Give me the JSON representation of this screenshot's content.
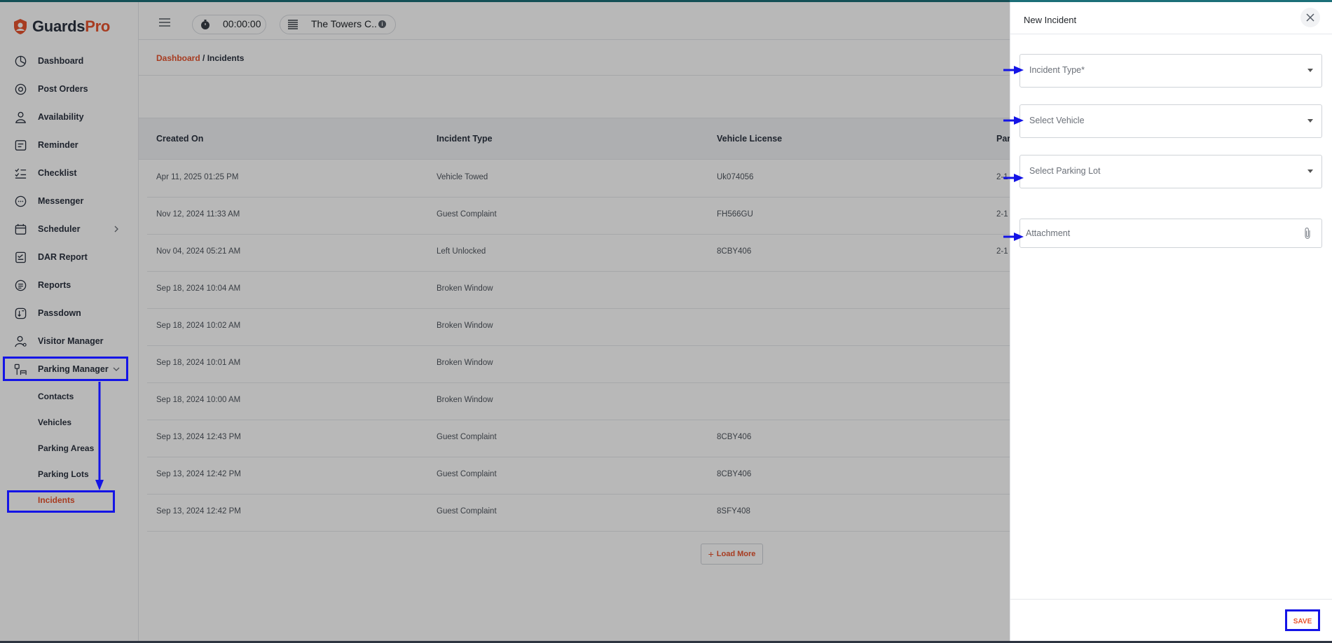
{
  "brand": {
    "part1": "Guards",
    "part2": "Pro"
  },
  "sidebar": {
    "items": [
      {
        "label": "Dashboard",
        "icon": "dashboard-icon"
      },
      {
        "label": "Post Orders",
        "icon": "post-orders-icon"
      },
      {
        "label": "Availability",
        "icon": "availability-icon"
      },
      {
        "label": "Reminder",
        "icon": "reminder-icon"
      },
      {
        "label": "Checklist",
        "icon": "checklist-icon"
      },
      {
        "label": "Messenger",
        "icon": "messenger-icon"
      },
      {
        "label": "Scheduler",
        "icon": "scheduler-icon"
      },
      {
        "label": "DAR Report",
        "icon": "dar-report-icon"
      },
      {
        "label": "Reports",
        "icon": "reports-icon"
      },
      {
        "label": "Passdown",
        "icon": "passdown-icon"
      },
      {
        "label": "Visitor Manager",
        "icon": "visitor-manager-icon"
      },
      {
        "label": "Parking Manager",
        "icon": "parking-manager-icon"
      }
    ],
    "sub_items": [
      {
        "label": "Contacts"
      },
      {
        "label": "Vehicles"
      },
      {
        "label": "Parking Areas"
      },
      {
        "label": "Parking Lots"
      },
      {
        "label": "Incidents",
        "active": true
      }
    ]
  },
  "topbar": {
    "timer": "00:00:00",
    "site": "The Towers C..",
    "info_glyph": "i"
  },
  "breadcrumb": {
    "parent": "Dashboard",
    "separator": " / ",
    "current": "Incidents"
  },
  "table": {
    "columns": [
      "Created On",
      "Incident Type",
      "Vehicle License",
      "Par"
    ],
    "rows": [
      {
        "created": "Apr 11, 2025 01:25 PM",
        "type": "Vehicle Towed",
        "license": "Uk074056",
        "par": "2-1"
      },
      {
        "created": "Nov 12, 2024 11:33 AM",
        "type": "Guest Complaint",
        "license": "FH566GU",
        "par": "2-1"
      },
      {
        "created": "Nov 04, 2024 05:21 AM",
        "type": "Left Unlocked",
        "license": "8CBY406",
        "par": "2-1"
      },
      {
        "created": "Sep 18, 2024 10:04 AM",
        "type": "Broken Window",
        "license": "",
        "par": ""
      },
      {
        "created": "Sep 18, 2024 10:02 AM",
        "type": "Broken Window",
        "license": "",
        "par": ""
      },
      {
        "created": "Sep 18, 2024 10:01 AM",
        "type": "Broken Window",
        "license": "",
        "par": ""
      },
      {
        "created": "Sep 18, 2024 10:00 AM",
        "type": "Broken Window",
        "license": "",
        "par": ""
      },
      {
        "created": "Sep 13, 2024 12:43 PM",
        "type": "Guest Complaint",
        "license": "8CBY406",
        "par": ""
      },
      {
        "created": "Sep 13, 2024 12:42 PM",
        "type": "Guest Complaint",
        "license": "8CBY406",
        "par": ""
      },
      {
        "created": "Sep 13, 2024 12:42 PM",
        "type": "Guest Complaint",
        "license": "8SFY408",
        "par": ""
      }
    ],
    "load_more": "Load More",
    "load_more_glyph": "+"
  },
  "panel": {
    "title": "New Incident",
    "fields": {
      "incident_type": "Incident Type*",
      "vehicle": "Select Vehicle",
      "parking_lot": "Select Parking Lot",
      "attachment": "Attachment"
    },
    "save": "SAVE"
  },
  "colors": {
    "accent": "#e8542f",
    "annotation": "#1414e6",
    "teal_top": "#1c6f78"
  }
}
